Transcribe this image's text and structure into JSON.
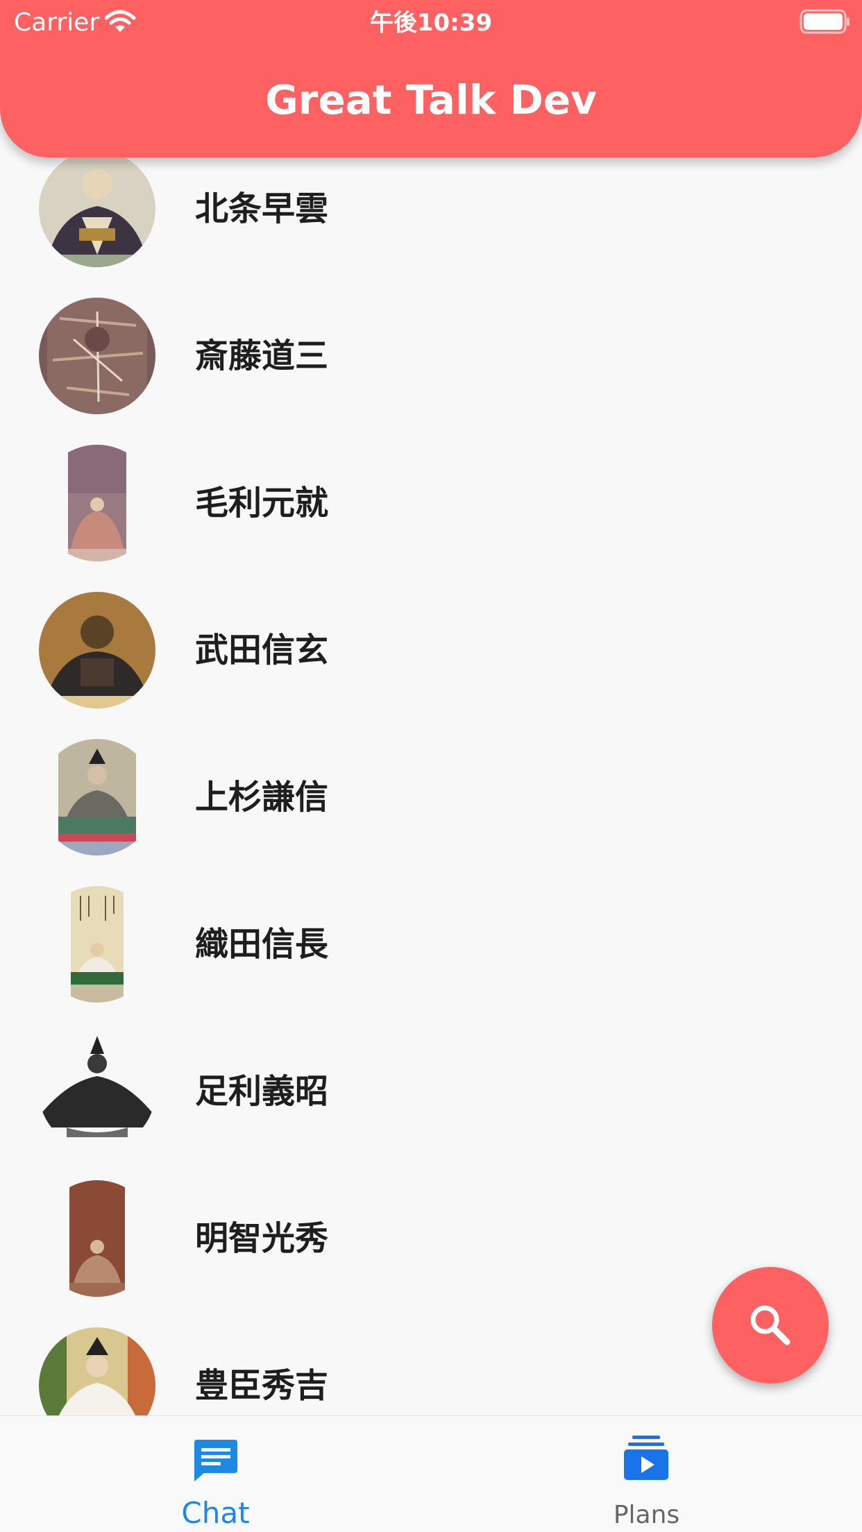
{
  "status_bar": {
    "carrier": "Carrier",
    "time": "午後10:39"
  },
  "app_bar": {
    "title": "Great Talk Dev",
    "color": "#fd6161"
  },
  "people": [
    {
      "name": "北条早雲"
    },
    {
      "name": "斎藤道三"
    },
    {
      "name": "毛利元就"
    },
    {
      "name": "武田信玄"
    },
    {
      "name": "上杉謙信"
    },
    {
      "name": "織田信長"
    },
    {
      "name": "足利義昭"
    },
    {
      "name": "明智光秀"
    },
    {
      "name": "豊臣秀吉"
    }
  ],
  "fab": {
    "icon": "search-icon"
  },
  "bottom_nav": {
    "items": [
      {
        "label": "Chat",
        "icon": "chat-icon",
        "active": true
      },
      {
        "label": "Plans",
        "icon": "subscriptions-icon",
        "active": false
      }
    ],
    "active_color": "#1e88e5"
  }
}
